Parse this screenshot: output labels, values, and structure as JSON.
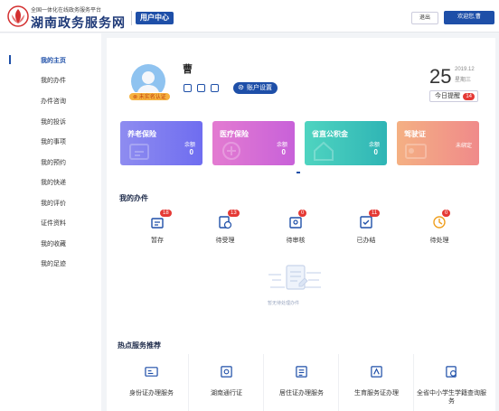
{
  "header": {
    "brand_sub": "全国一体化在线政务服务平台",
    "brand_main": "湖南政务服务网",
    "user_center": "用户中心",
    "logout": "退出",
    "welcome": "欢迎您,曹"
  },
  "sidebar": {
    "items": [
      {
        "label": "我的主页",
        "active": true
      },
      {
        "label": "我的办件"
      },
      {
        "label": "办件咨询"
      },
      {
        "label": "我的投诉"
      },
      {
        "label": "我的事项"
      },
      {
        "label": "我的预约"
      },
      {
        "label": "我的快递"
      },
      {
        "label": "我的评价"
      },
      {
        "label": "证件资料"
      },
      {
        "label": "我的收藏"
      },
      {
        "label": "我的足迹"
      }
    ]
  },
  "profile": {
    "name": "曹",
    "badge": "未实名认证",
    "account_settings": "账户设置"
  },
  "date": {
    "day": "25",
    "year_month": "2019.12",
    "weekday": "星期三",
    "today_reminder": "今日提醒",
    "today_count": "14"
  },
  "cards": [
    {
      "title": "养老保险",
      "label": "余额",
      "value": "0"
    },
    {
      "title": "医疗保险",
      "label": "余额",
      "value": "0"
    },
    {
      "title": "省直公积金",
      "label": "余额",
      "value": "0"
    },
    {
      "title": "驾驶证",
      "label": "未绑定",
      "value": ""
    }
  ],
  "my_tasks": {
    "title": "我的办件",
    "items": [
      {
        "label": "暂存",
        "count": "18"
      },
      {
        "label": "待受理",
        "count": "13"
      },
      {
        "label": "待审核",
        "count": "0"
      },
      {
        "label": "已办结",
        "count": "11"
      },
      {
        "label": "待处理",
        "count": "0"
      }
    ],
    "empty_text": "暂无待处理办件"
  },
  "hot_services": {
    "title": "热点服务推荐",
    "items": [
      {
        "label": "身份证办理服务"
      },
      {
        "label": "湖南通行证"
      },
      {
        "label": "居住证办理服务"
      },
      {
        "label": "生育服务证办理"
      },
      {
        "label": "全省中小学生学籍查询服务"
      }
    ]
  },
  "colors": {
    "brand": "#1e4fa8",
    "badge_red": "#e53935",
    "card_gradients": [
      [
        "#8e8cf0",
        "#6f6df0"
      ],
      [
        "#e37bd1",
        "#c861d9"
      ],
      [
        "#4fd4c0",
        "#2fb5b5"
      ],
      [
        "#f4b083",
        "#f08a8a"
      ]
    ]
  }
}
